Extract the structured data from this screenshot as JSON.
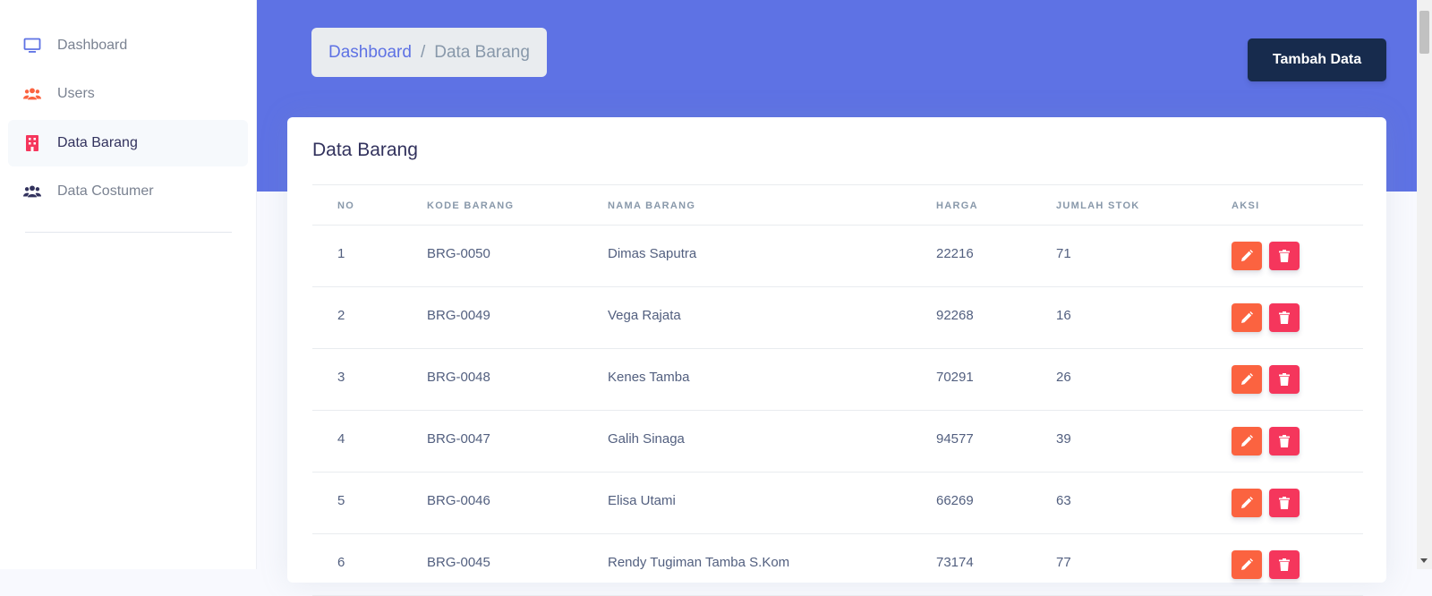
{
  "sidebar": {
    "items": [
      {
        "label": "Dashboard",
        "icon": "monitor-icon",
        "color": "#5e72e4"
      },
      {
        "label": "Users",
        "icon": "users-icon",
        "color": "#fb6340"
      },
      {
        "label": "Data Barang",
        "icon": "building-icon",
        "color": "#f5365c",
        "active": true
      },
      {
        "label": "Data Costumer",
        "icon": "users-icon",
        "color": "#32325d"
      }
    ]
  },
  "breadcrumb": {
    "home": "Dashboard",
    "separator": "/",
    "current": "Data Barang"
  },
  "header": {
    "add_button_label": "Tambah Data"
  },
  "card": {
    "title": "Data Barang"
  },
  "table": {
    "columns": [
      "NO",
      "KODE BARANG",
      "NAMA BARANG",
      "HARGA",
      "JUMLAH STOK",
      "AKSI"
    ],
    "rows": [
      {
        "no": "1",
        "kode": "BRG-0050",
        "nama": "Dimas Saputra",
        "harga": "22216",
        "stok": "71"
      },
      {
        "no": "2",
        "kode": "BRG-0049",
        "nama": "Vega Rajata",
        "harga": "92268",
        "stok": "16"
      },
      {
        "no": "3",
        "kode": "BRG-0048",
        "nama": "Kenes Tamba",
        "harga": "70291",
        "stok": "26"
      },
      {
        "no": "4",
        "kode": "BRG-0047",
        "nama": "Galih Sinaga",
        "harga": "94577",
        "stok": "39"
      },
      {
        "no": "5",
        "kode": "BRG-0046",
        "nama": "Elisa Utami",
        "harga": "66269",
        "stok": "63"
      },
      {
        "no": "6",
        "kode": "BRG-0045",
        "nama": "Rendy Tugiman Tamba S.Kom",
        "harga": "73174",
        "stok": "77"
      }
    ]
  },
  "colors": {
    "primary": "#5e72e4",
    "dark": "#172b4d",
    "edit": "#fb6340",
    "delete": "#f5365c"
  }
}
